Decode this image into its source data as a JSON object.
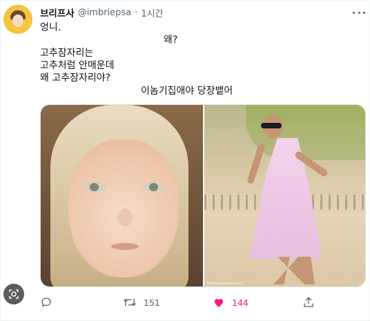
{
  "tweet": {
    "author_name": "브리프사",
    "handle": "@imbriepsa",
    "separator": "·",
    "time": "1시간",
    "lines": [
      "엉니.",
      "왜?",
      "고추잠자리는",
      "고추처럼 안매운데",
      "왜 고추잠자리야?",
      "이놈기집애야 당장뱉어"
    ],
    "image_credit": "TheImageDirect.com"
  },
  "actions": {
    "reply_count": "",
    "retweet_count": "151",
    "like_count": "144",
    "like_color": "#f91880"
  },
  "icons": {
    "more": "more-icon",
    "reply": "reply-icon",
    "retweet": "retweet-icon",
    "like": "heart-icon",
    "share": "share-icon",
    "lens": "lens-icon"
  },
  "colors": {
    "secondary_text": "#536471",
    "primary_text": "#0f1419"
  }
}
